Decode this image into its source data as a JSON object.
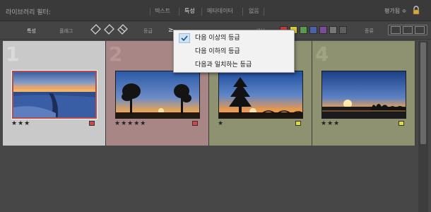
{
  "topbar": {
    "title": "라이브러리 필터:",
    "tabs": [
      {
        "label": "텍스트",
        "active": false
      },
      {
        "label": "특성",
        "active": true
      },
      {
        "label": "메타데이터",
        "active": false
      },
      {
        "label": "없음",
        "active": false
      }
    ],
    "filter_set": "평가됨 ≑"
  },
  "filterbar": {
    "attribute_label": "특성",
    "flag_label": "플래그",
    "rating_label": "등급",
    "rating_operator": "≥",
    "color_label": "색상",
    "kind_label": "종류",
    "color_swatches": [
      "#c23a3a",
      "#d8c93a",
      "#5a9a4e",
      "#4c62a8",
      "#7a4c9a",
      "#777777",
      "#5f5f5f"
    ]
  },
  "dropdown": {
    "items": [
      {
        "label": "다음 이상의 등급",
        "checked": true
      },
      {
        "label": "다음 이하의 등급",
        "checked": false
      },
      {
        "label": "다음과 일치하는 등급",
        "checked": false
      }
    ]
  },
  "grid": {
    "cells": [
      {
        "number": "1",
        "stars": "★★★",
        "rating": 3,
        "bg": "#c9c9c9",
        "label_color": "#d24646",
        "selected": true,
        "thumb": "winter-sunset"
      },
      {
        "number": "2",
        "stars": "★★★★★",
        "rating": 5,
        "bg": "#a88686",
        "label_color": "#d24646",
        "selected": false,
        "thumb": "tree-sunset"
      },
      {
        "number": "3",
        "stars": "★",
        "rating": 1,
        "bg": "#8e9270",
        "label_color": "#e4d83c",
        "selected": false,
        "thumb": "pine-sunset"
      },
      {
        "number": "4",
        "stars": "★★★",
        "rating": 3,
        "bg": "#8e9270",
        "label_color": "#e4d83c",
        "selected": false,
        "thumb": "sea-sunset"
      }
    ]
  }
}
